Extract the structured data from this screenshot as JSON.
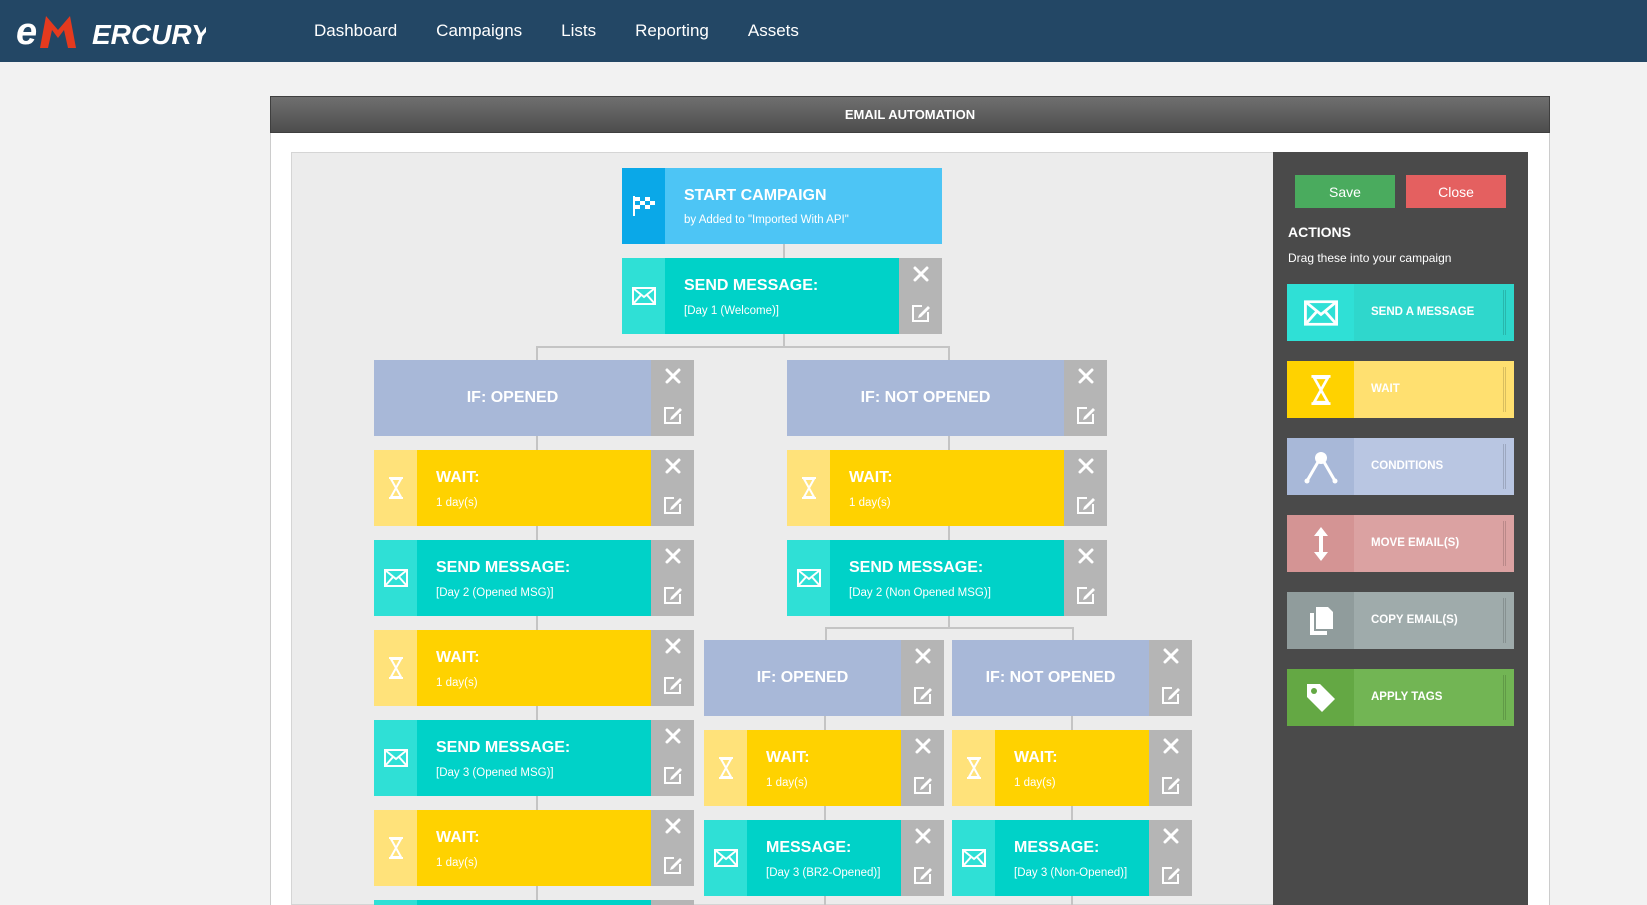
{
  "app": {
    "logo_text": "eMERCURY"
  },
  "nav": {
    "items": [
      "Dashboard",
      "Campaigns",
      "Lists",
      "Reporting",
      "Assets"
    ]
  },
  "panel": {
    "title": "EMAIL AUTOMATION"
  },
  "sidebar": {
    "save_label": "Save",
    "close_label": "Close",
    "title": "ACTIONS",
    "subtitle": "Drag these into your campaign",
    "actions": [
      {
        "label": "SEND A MESSAGE",
        "icon": "envelope-icon",
        "color": "#2fd7cc",
        "icon_bg": "#2fe0d6"
      },
      {
        "label": "WAIT",
        "icon": "hourglass-icon",
        "color": "#ffe070",
        "icon_bg": "#ffd200"
      },
      {
        "label": "CONDITIONS",
        "icon": "branch-icon",
        "color": "#b9c6e2",
        "icon_bg": "#a8b8d8"
      },
      {
        "label": "MOVE EMAIL(S)",
        "icon": "move-arrows-icon",
        "color": "#dba2a2",
        "icon_bg": "#d49494"
      },
      {
        "label": "COPY EMAIL(S)",
        "icon": "copy-icon",
        "color": "#9fabab",
        "icon_bg": "#909c9c"
      },
      {
        "label": "APPLY TAGS",
        "icon": "tag-icon",
        "color": "#72b554",
        "icon_bg": "#64a844"
      }
    ]
  },
  "flow": {
    "start": {
      "title": "START CAMPAIGN",
      "sub": "by Added to \"Imported With API\""
    },
    "send1": {
      "title": "SEND MESSAGE:",
      "sub": "[Day 1 (Welcome)]"
    },
    "if_opened_1": {
      "title": "IF: OPENED"
    },
    "if_not_opened_1": {
      "title": "IF: NOT OPENED"
    },
    "wait_l1": {
      "title": "WAIT:",
      "sub": "1 day(s)"
    },
    "wait_r1": {
      "title": "WAIT:",
      "sub": "1 day(s)"
    },
    "send_l2": {
      "title": "SEND MESSAGE:",
      "sub": "[Day 2 (Opened MSG)]"
    },
    "send_r2": {
      "title": "SEND MESSAGE:",
      "sub": "[Day 2 (Non Opened MSG)]"
    },
    "wait_l2": {
      "title": "WAIT:",
      "sub": "1 day(s)"
    },
    "send_l3": {
      "title": "SEND MESSAGE:",
      "sub": "[Day 3 (Opened MSG)]"
    },
    "wait_l3": {
      "title": "WAIT:",
      "sub": "1 day(s)"
    },
    "if_opened_2": {
      "title": "IF: OPENED"
    },
    "if_not_opened_2": {
      "title": "IF: NOT OPENED"
    },
    "wait_m1": {
      "title": "WAIT:",
      "sub": "1 day(s)"
    },
    "wait_m2": {
      "title": "WAIT:",
      "sub": "1 day(s)"
    },
    "msg_m1": {
      "title": "MESSAGE:",
      "sub": "[Day 3 (BR2-Opened)]"
    },
    "msg_m2": {
      "title": "MESSAGE:",
      "sub": "[Day 3 (Non-Opened)]"
    }
  }
}
